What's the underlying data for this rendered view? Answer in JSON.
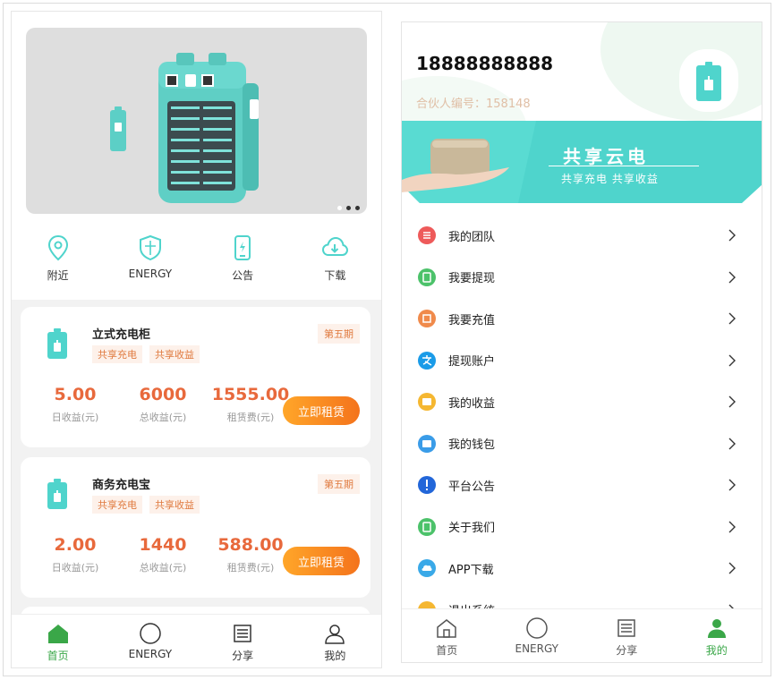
{
  "colors": {
    "accent_green": "#3aa748",
    "teal": "#4fd4cc",
    "orange": "#e8693c",
    "button_gradient": [
      "#ffa629",
      "#f4731c"
    ]
  },
  "left": {
    "quick_links": [
      {
        "label": "附近",
        "icon": "location-pin-icon"
      },
      {
        "label": "ENERGY",
        "icon": "shield-icon"
      },
      {
        "label": "公告",
        "icon": "phone-icon"
      },
      {
        "label": "下载",
        "icon": "cloud-download-icon"
      }
    ],
    "products": [
      {
        "title": "立式充电柜",
        "period": "第五期",
        "tags": [
          "共享充电",
          "共享收益"
        ],
        "daily_income": "5.00",
        "daily_income_label": "日收益(元)",
        "total_income": "6000",
        "total_income_label": "总收益(元)",
        "rent_fee": "1555.00",
        "rent_fee_label": "租赁费(元)",
        "button": "立即租赁"
      },
      {
        "title": "商务充电宝",
        "period": "第五期",
        "tags": [
          "共享充电",
          "共享收益"
        ],
        "daily_income": "2.00",
        "daily_income_label": "日收益(元)",
        "total_income": "1440",
        "total_income_label": "总收益(元)",
        "rent_fee": "588.00",
        "rent_fee_label": "租赁费(元)",
        "button": "立即租赁"
      }
    ],
    "tabs": [
      {
        "label": "首页",
        "icon": "home-icon",
        "active": true
      },
      {
        "label": "ENERGY",
        "icon": "circle-icon",
        "active": false
      },
      {
        "label": "分享",
        "icon": "share-list-icon",
        "active": false
      },
      {
        "label": "我的",
        "icon": "user-icon",
        "active": false
      }
    ]
  },
  "right": {
    "phone": "18888888888",
    "partner_id": "合伙人编号：158148",
    "promo": {
      "title": "共享云电",
      "subtitle": "共享充电 共享收益"
    },
    "menu": [
      {
        "label": "我的团队",
        "icon": "team-icon",
        "color": "#ee5a5a"
      },
      {
        "label": "我要提现",
        "icon": "withdraw-icon",
        "color": "#4cc26a"
      },
      {
        "label": "我要充值",
        "icon": "recharge-icon",
        "color": "#f08a4b"
      },
      {
        "label": "提现账户",
        "icon": "alipay-icon",
        "color": "#1a9be8"
      },
      {
        "label": "我的收益",
        "icon": "income-icon",
        "color": "#f5b731"
      },
      {
        "label": "我的钱包",
        "icon": "wallet-icon",
        "color": "#3a9ce8"
      },
      {
        "label": "平台公告",
        "icon": "notice-icon",
        "color": "#2266d9"
      },
      {
        "label": "关于我们",
        "icon": "about-icon",
        "color": "#4cc26a"
      },
      {
        "label": "APP下载",
        "icon": "cloud-icon",
        "color": "#3aa9e8"
      },
      {
        "label": "退出系统",
        "icon": "logout-icon",
        "color": "#f5b731"
      }
    ],
    "tabs": [
      {
        "label": "首页",
        "icon": "home-icon",
        "active": false
      },
      {
        "label": "ENERGY",
        "icon": "circle-icon",
        "active": false
      },
      {
        "label": "分享",
        "icon": "share-list-icon",
        "active": false
      },
      {
        "label": "我的",
        "icon": "user-icon",
        "active": true
      }
    ]
  }
}
